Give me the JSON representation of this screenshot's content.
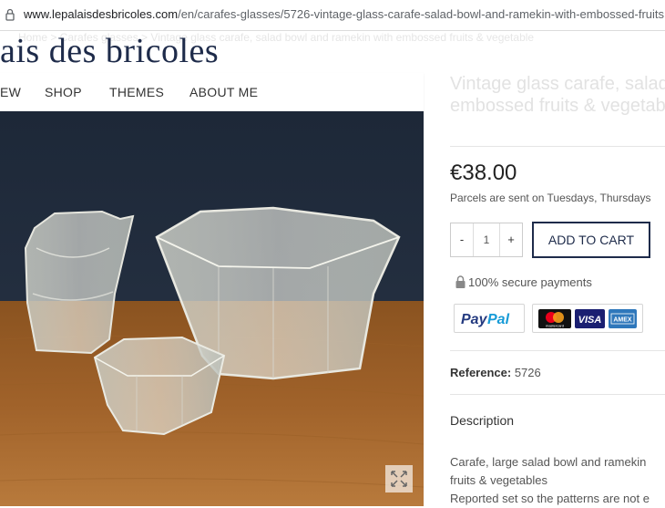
{
  "browser": {
    "url_host": "www.lepalaisdesbricoles.com",
    "url_path": "/en/carafes-glasses/5726-vintage-glass-carafe-salad-bowl-and-ramekin-with-embossed-fruits"
  },
  "breadcrumb_ghost": "Home > Carafes glasses > Vintage glass carafe, salad bowl and ramekin with embossed fruits & vegetable",
  "brand": "ais des bricoles",
  "nav": [
    "EW",
    "SHOP",
    "THEMES",
    "ABOUT ME"
  ],
  "product": {
    "title_line1": "Vintage glass carafe, salad",
    "title_line2": "embossed fruits & vegetab",
    "price": "€38.00",
    "shipping_note": "Parcels are sent on Tuesdays, Thursdays",
    "qty_minus": "-",
    "qty_value": "1",
    "qty_plus": "+",
    "add_to_cart": "ADD TO CART",
    "secure_payments": "100% secure payments",
    "payment_methods": [
      "PayPal",
      "mastercard",
      "VISA",
      "AMEX"
    ],
    "reference_label": "Reference:",
    "reference_value": "5726",
    "description_heading": "Description",
    "description_line1": "Carafe, large salad bowl and ramekin",
    "description_line2": "fruits & vegetables",
    "description_line3": "Reported set so the patterns are not e"
  },
  "colors": {
    "brand_navy": "#1e2b4a",
    "paypal_dark": "#253b80",
    "paypal_light": "#179bd7",
    "visa_blue": "#1a1f71",
    "amex_blue": "#2e77bb"
  },
  "icons": [
    "lock-icon",
    "expand-icon"
  ]
}
